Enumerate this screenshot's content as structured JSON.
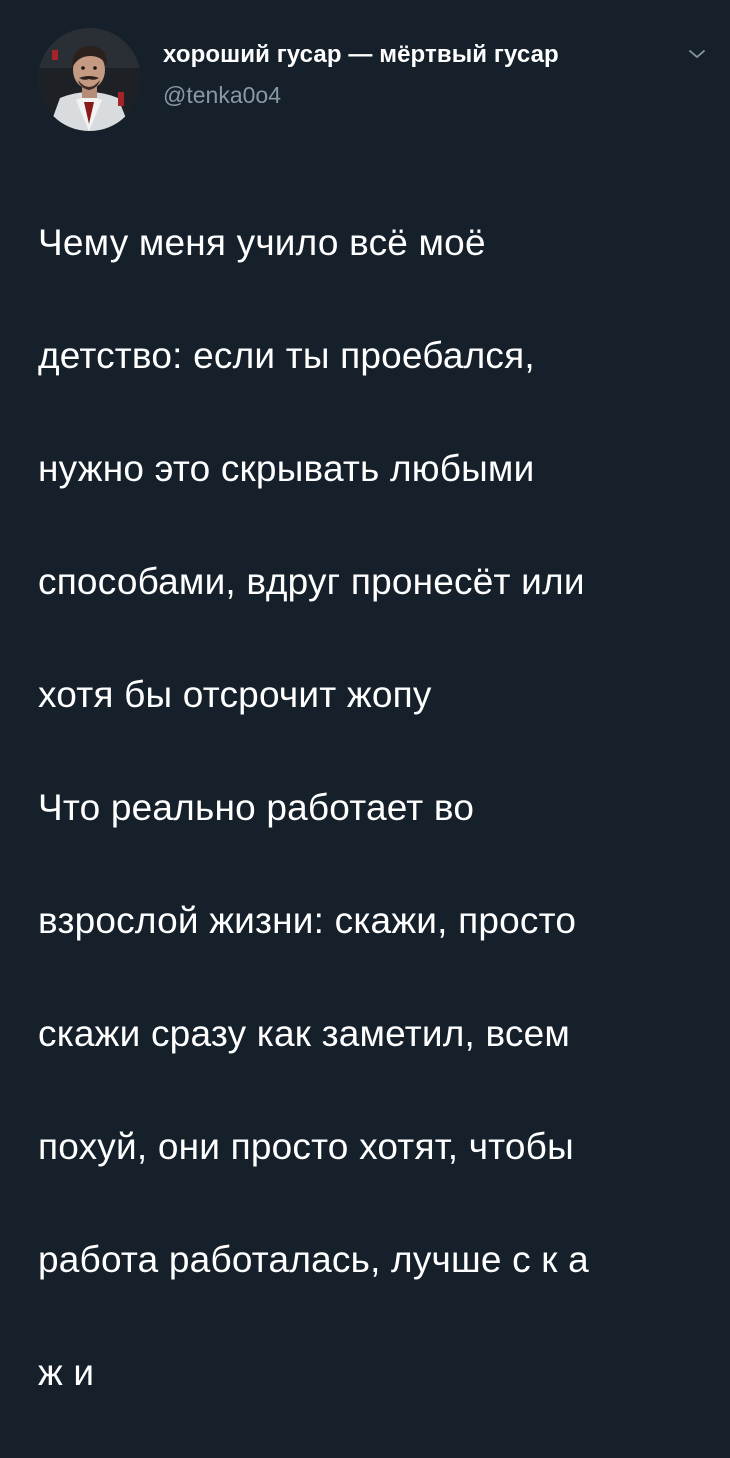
{
  "tweet": {
    "author": {
      "display_name": "хороший гусар — мёртвый гусар",
      "handle": "@tenka0o4",
      "avatar_icon": "user-avatar"
    },
    "menu_icon": "chevron-down-icon",
    "lines": [
      "Чему меня учило всё моё",
      "детство: если ты проебался,",
      "нужно это скрывать любыми",
      "способами, вдруг пронесёт или",
      "хотя бы отсрочит жопу",
      "Что реально работает во",
      "взрослой жизни: скажи, просто",
      "скажи сразу как заметил, всем",
      "похуй, они просто хотят, чтобы",
      "работа работалась, лучше с к а",
      "ж и"
    ]
  },
  "colors": {
    "background": "#15202b",
    "text_primary": "#ffffff",
    "text_secondary": "#8899a6"
  }
}
